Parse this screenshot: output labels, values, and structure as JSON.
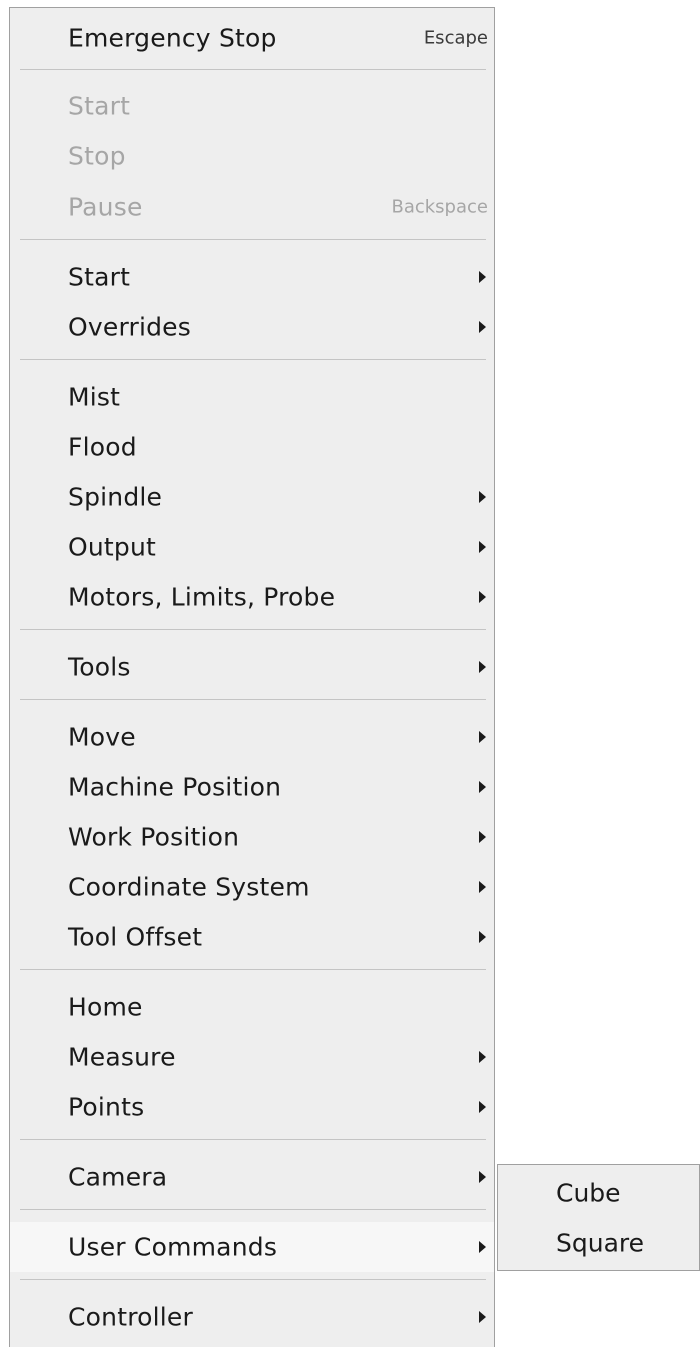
{
  "menu": {
    "items": [
      {
        "label": "Emergency Stop",
        "shortcut": "Escape",
        "disabled": false,
        "submenu": false
      },
      {
        "label": "Start",
        "shortcut": "",
        "disabled": true,
        "submenu": false
      },
      {
        "label": "Stop",
        "shortcut": "",
        "disabled": true,
        "submenu": false
      },
      {
        "label": "Pause",
        "shortcut": "Backspace",
        "disabled": true,
        "submenu": false
      },
      {
        "label": "Start",
        "shortcut": "",
        "disabled": false,
        "submenu": true
      },
      {
        "label": "Overrides",
        "shortcut": "",
        "disabled": false,
        "submenu": true
      },
      {
        "label": "Mist",
        "shortcut": "",
        "disabled": false,
        "submenu": false
      },
      {
        "label": "Flood",
        "shortcut": "",
        "disabled": false,
        "submenu": false
      },
      {
        "label": "Spindle",
        "shortcut": "",
        "disabled": false,
        "submenu": true
      },
      {
        "label": "Output",
        "shortcut": "",
        "disabled": false,
        "submenu": true
      },
      {
        "label": "Motors, Limits, Probe",
        "shortcut": "",
        "disabled": false,
        "submenu": true
      },
      {
        "label": "Tools",
        "shortcut": "",
        "disabled": false,
        "submenu": true
      },
      {
        "label": "Move",
        "shortcut": "",
        "disabled": false,
        "submenu": true
      },
      {
        "label": "Machine Position",
        "shortcut": "",
        "disabled": false,
        "submenu": true
      },
      {
        "label": "Work Position",
        "shortcut": "",
        "disabled": false,
        "submenu": true
      },
      {
        "label": "Coordinate System",
        "shortcut": "",
        "disabled": false,
        "submenu": true
      },
      {
        "label": "Tool Offset",
        "shortcut": "",
        "disabled": false,
        "submenu": true
      },
      {
        "label": "Home",
        "shortcut": "",
        "disabled": false,
        "submenu": false
      },
      {
        "label": "Measure",
        "shortcut": "",
        "disabled": false,
        "submenu": true
      },
      {
        "label": "Points",
        "shortcut": "",
        "disabled": false,
        "submenu": true
      },
      {
        "label": "Camera",
        "shortcut": "",
        "disabled": false,
        "submenu": true
      },
      {
        "label": "User Commands",
        "shortcut": "",
        "disabled": false,
        "submenu": true
      },
      {
        "label": "Controller",
        "shortcut": "",
        "disabled": false,
        "submenu": true
      }
    ]
  },
  "submenu": {
    "parent": "User Commands",
    "items": [
      {
        "label": "Cube"
      },
      {
        "label": "Square"
      }
    ]
  }
}
